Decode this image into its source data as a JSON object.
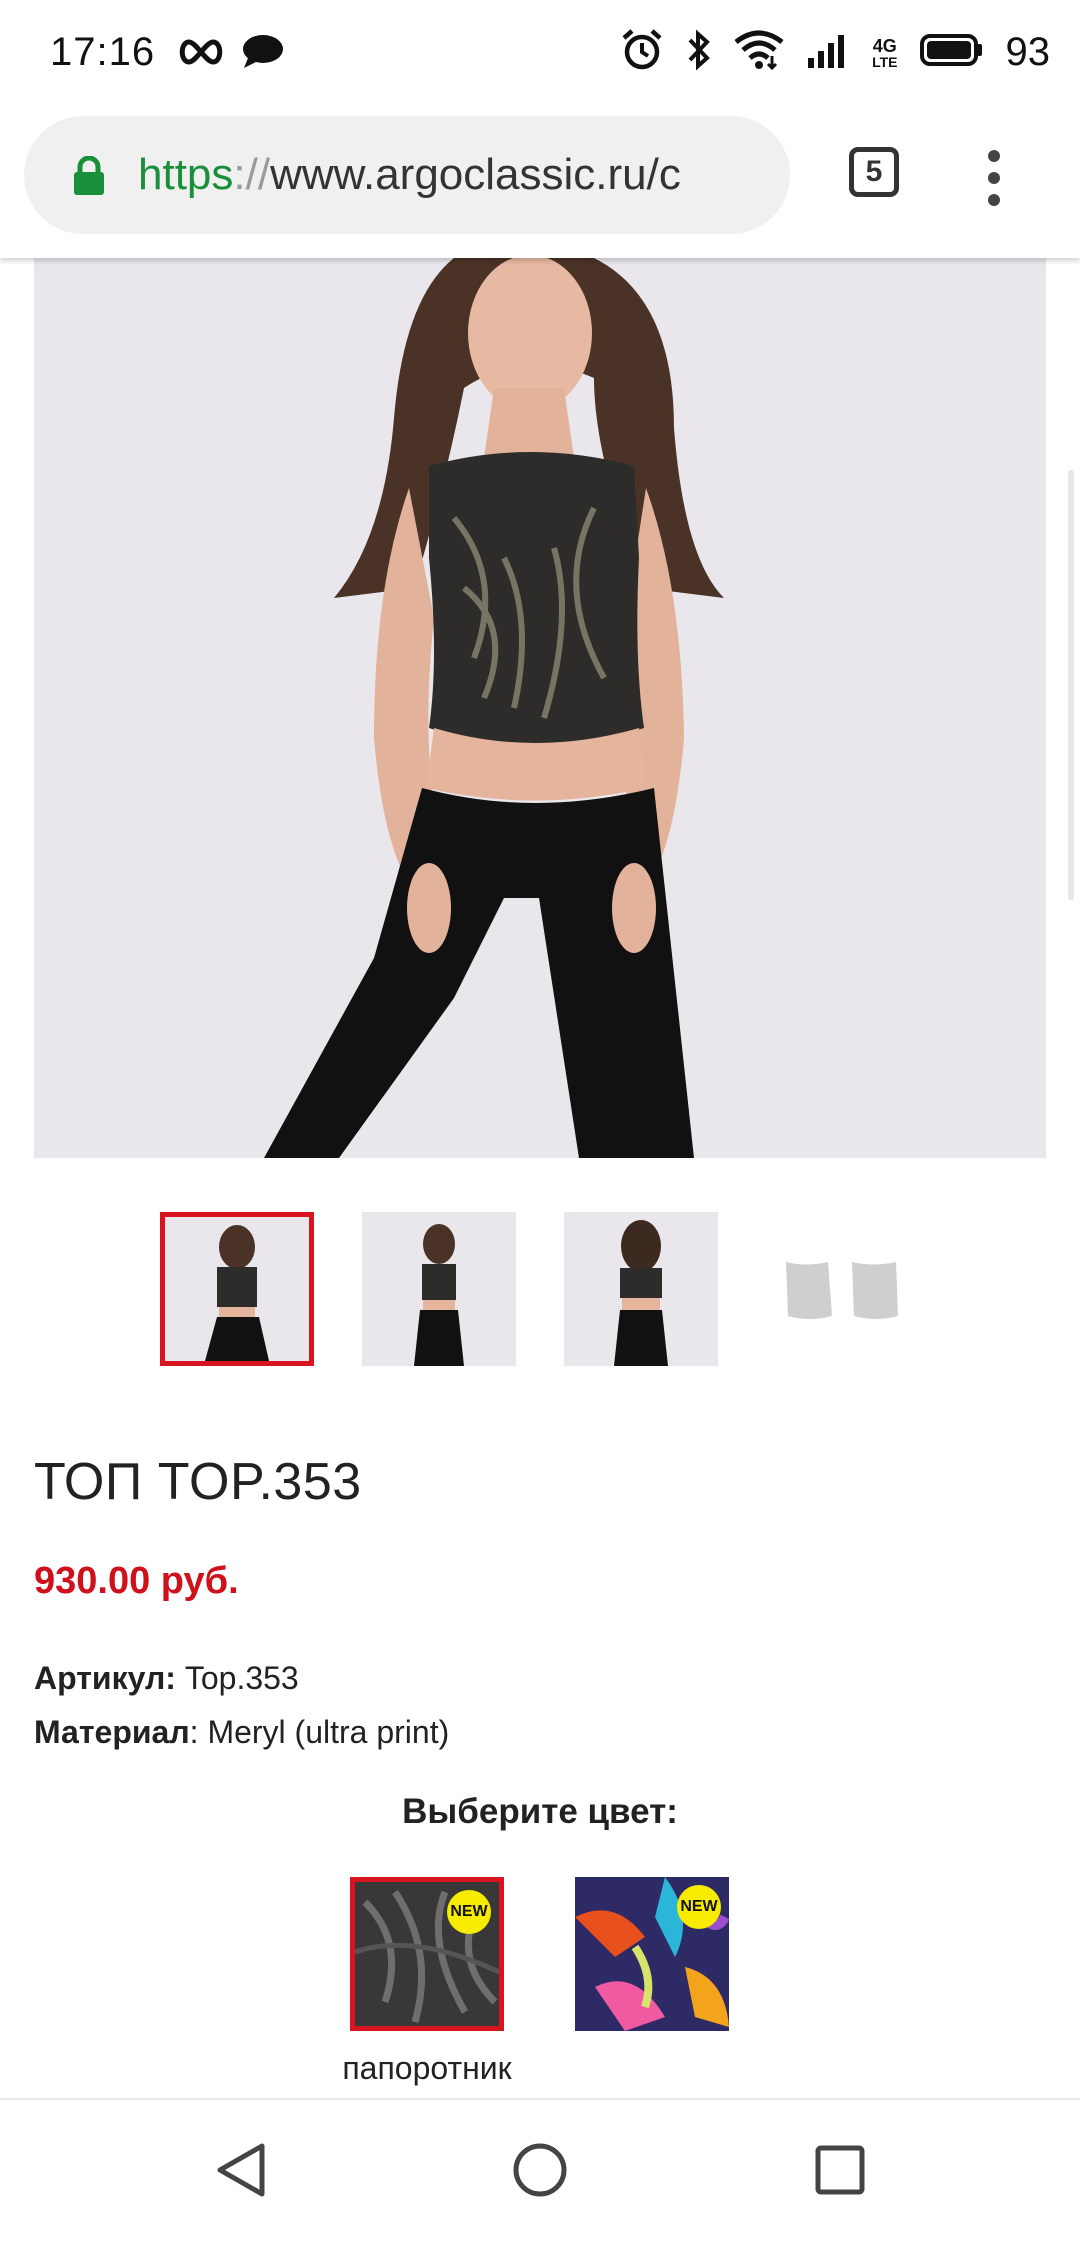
{
  "status_bar": {
    "time": "17:16",
    "battery": "93",
    "icons": [
      "infinity-icon",
      "chat-bubble-icon",
      "alarm-icon",
      "bluetooth-icon",
      "wifi-icon",
      "signal-icon",
      "4g-lte-icon",
      "battery-icon"
    ],
    "network_label_top": "4G",
    "network_label_bottom": "LTE"
  },
  "browser": {
    "url_scheme": "https",
    "url_sep": "://",
    "url_rest": "www.argoclassic.ru/c",
    "tab_count": "5"
  },
  "product": {
    "title": "ТОП TOP.353",
    "price": "930.00 руб.",
    "sku_label": "Артикул:",
    "sku_value": " Top.353",
    "material_label": "Материал",
    "material_value": ": Meryl (ultra print)",
    "choose_color": "Выберите цвет:",
    "thumbnails": [
      "front-close",
      "front-full",
      "back",
      "flat-lay"
    ],
    "swatches": [
      {
        "name": "папоротник",
        "badge": "NEW",
        "selected": true
      },
      {
        "name": "",
        "badge": "NEW",
        "selected": false
      }
    ]
  },
  "colors": {
    "accent_red": "#d7141f",
    "price_red": "#d0101b",
    "url_green": "#1a8f3a",
    "badge_yellow": "#f7ec00"
  }
}
